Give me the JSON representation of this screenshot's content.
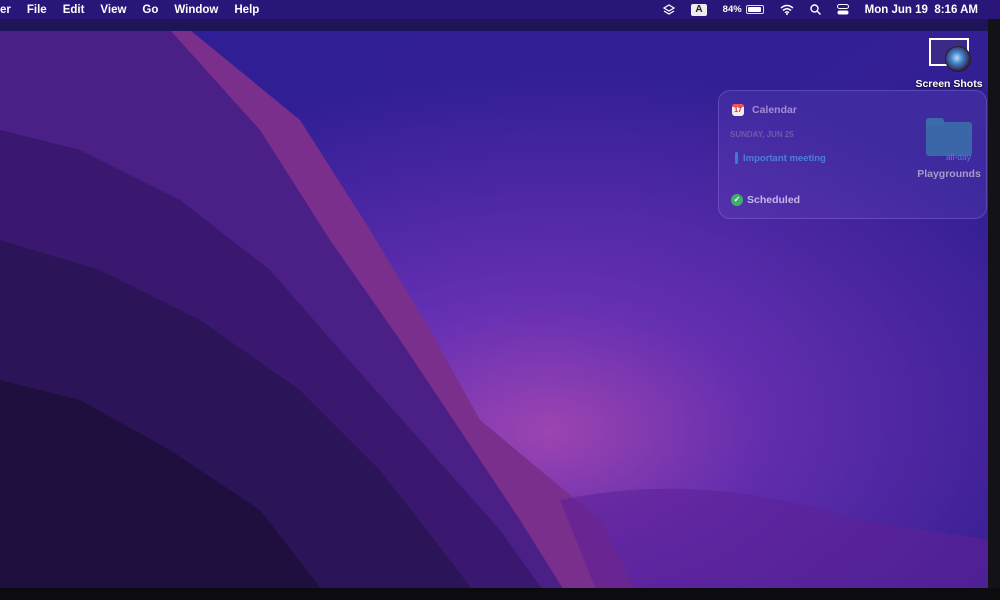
{
  "menubar": {
    "app_name": "er",
    "items": [
      "File",
      "Edit",
      "View",
      "Go",
      "Window",
      "Help"
    ],
    "status": {
      "layers_icon": "layers-icon",
      "input_source": "A",
      "battery_percent": "84%",
      "battery_level": 0.84,
      "wifi_icon": "wifi-icon",
      "search_icon": "search-icon",
      "control_center_icon": "control-center-icon",
      "datetime": "Mon Jun 19  8:16 AM"
    }
  },
  "desktop": {
    "icons": [
      {
        "label": "Screen Shots"
      },
      {
        "label": "Playgrounds"
      }
    ]
  },
  "widget": {
    "app": "Calendar",
    "calendar_icon_day": "17",
    "date": "SUNDAY, JUN 25",
    "event": "Important meeting",
    "event_time": "all-day",
    "status": "Scheduled",
    "event_color": "#3d7ae0"
  }
}
